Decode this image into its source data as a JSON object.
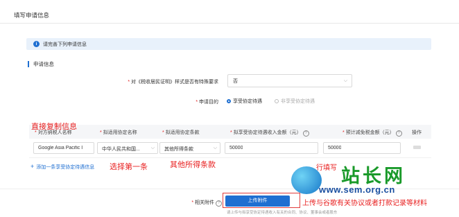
{
  "page": {
    "title": "填写申请信息"
  },
  "notice": {
    "text": "请完善下列申请信息"
  },
  "section": {
    "title": "申请信息"
  },
  "form": {
    "special_req_label": "对《税收居民证明》样式是否有特殊要求",
    "special_req_value": "否",
    "purpose_label": "申请目的",
    "purpose_options": [
      "享受协定待遇",
      "非享受协定待遇"
    ],
    "purpose_selected": "享受协定待遇"
  },
  "table": {
    "headers": [
      "对方纳税人名称",
      "拟适用协定名称",
      "拟适用协定条款",
      "拟享受协定待遇收入金额（元）",
      "预计减免税金额（元）",
      "操作"
    ],
    "row": {
      "taxpayer": "Google Asia Pacific I",
      "treaty": "中华人民共和国...",
      "clause": "其他所得条款",
      "income": "50000",
      "reduction": "50000"
    },
    "add_link": "添加一条享受协定待遇信息"
  },
  "attachment": {
    "label": "相关附件",
    "button": "上传附件",
    "hint": "请上传与拟享受协定待遇收入有关的合同、协议、董事会或者股东"
  },
  "annotations": {
    "copy": "直接复制信息",
    "choose_first": "选择第一条",
    "other_clause": "其他所得条款",
    "fill_in": "行填写",
    "upload_note": "上传与谷歌有关协议或者打款记录等材料"
  },
  "watermark": {
    "name": "站长网",
    "url": "www.sem.org.cn"
  },
  "colors": {
    "primary": "#1f6fd1",
    "annotation": "#e82020",
    "notice_bg": "#e8f1fb"
  }
}
